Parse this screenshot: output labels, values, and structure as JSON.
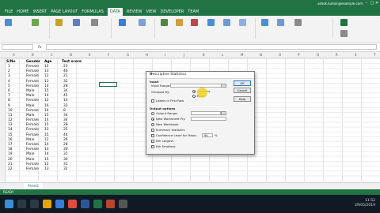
{
  "app": {
    "account": "ashok.kumar@example.com"
  },
  "ribbon": {
    "tabs": [
      "FILE",
      "HOME",
      "INSERT",
      "PAGE LAYOUT",
      "FORMULAS",
      "DATA",
      "REVIEW",
      "VIEW",
      "DEVELOPER",
      "TEAM"
    ],
    "active_tab": "DATA"
  },
  "formula_bar": {
    "name_box": "",
    "fx": "fx"
  },
  "columns": [
    "A",
    "B",
    "C",
    "D",
    "E",
    "F",
    "G",
    "H",
    "I",
    "J",
    "K",
    "L",
    "M",
    "N",
    "O",
    "P",
    "Q",
    "R",
    "S",
    "T"
  ],
  "table": {
    "headers": [
      "S/No",
      "Gender",
      "Age",
      "Test score"
    ],
    "rows": [
      [
        "1",
        "Female",
        "12",
        "23"
      ],
      [
        "2",
        "Female",
        "13",
        "46"
      ],
      [
        "3",
        "Female",
        "12",
        "21"
      ],
      [
        "4",
        "Female",
        "13",
        "32"
      ],
      [
        "5",
        "Female",
        "14",
        "28"
      ],
      [
        "6",
        "Male",
        "15",
        "34"
      ],
      [
        "7",
        "Male",
        "14",
        "45"
      ],
      [
        "8",
        "Female",
        "12",
        "13"
      ],
      [
        "9",
        "Male",
        "16",
        "32"
      ],
      [
        "10",
        "Female",
        "14",
        "8"
      ],
      [
        "11",
        "Male",
        "15",
        "34"
      ],
      [
        "12",
        "Female",
        "14",
        "34"
      ],
      [
        "13",
        "Female",
        "15",
        "29"
      ],
      [
        "14",
        "Female",
        "13",
        "25"
      ],
      [
        "15",
        "Female",
        "15",
        "44"
      ],
      [
        "16",
        "Male",
        "12",
        "26"
      ],
      [
        "17",
        "Female",
        "14",
        "28"
      ],
      [
        "18",
        "Female",
        "13",
        "30"
      ],
      [
        "19",
        "Male",
        "14",
        "31"
      ],
      [
        "20",
        "Male",
        "15",
        "30"
      ],
      [
        "21",
        "Female",
        "12",
        "31"
      ],
      [
        "22",
        "Female",
        "13",
        "32"
      ]
    ]
  },
  "sheet_tab": "Sheet1",
  "status": "READY",
  "dialog": {
    "title": "Descriptive Statistics",
    "input_group": "Input",
    "input_range_label": "Input Range:",
    "grouped_by_label": "Grouped By:",
    "columns_option": "Columns",
    "rows_option": "Rows",
    "labels_first_row": "Labels in First Row",
    "output_group": "Output options",
    "output_range": "Output Range:",
    "new_worksheet": "New Worksheet Ply:",
    "new_workbook": "New Workbook",
    "summary_stats": "Summary statistics",
    "confidence": "Confidence Level for Mean:",
    "confidence_value": "95",
    "confidence_unit": "%",
    "kth_largest": "Kth Largest:",
    "kth_smallest": "Kth Smallest:",
    "ok": "OK",
    "cancel": "Cancel",
    "help": "Help"
  },
  "taskbar": {
    "time": "11:52",
    "date": "29/05/2019"
  },
  "colors": {
    "excel_green": "#217346",
    "accent_blue": "#2a7bd4"
  }
}
